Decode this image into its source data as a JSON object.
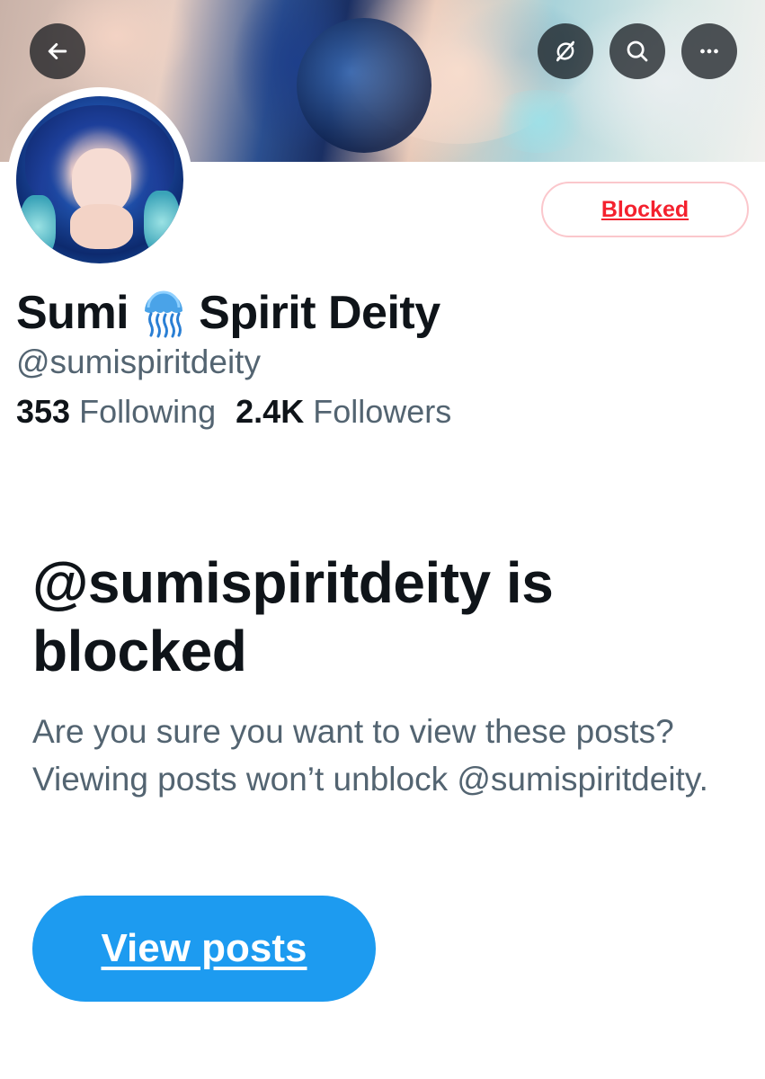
{
  "header": {
    "back_icon": "arrow-left-icon",
    "sync_icon": "no-sync-icon",
    "search_icon": "search-icon",
    "more_icon": "more-horizontal-icon"
  },
  "profile": {
    "blocked_label": "Blocked",
    "display_name_first": "Sumi",
    "display_name_emoji": "jellyfish-icon",
    "display_name_last": "Spirit Deity",
    "handle": "@sumispiritdeity",
    "following_count": "353",
    "following_label": "Following",
    "followers_count": "2.4K",
    "followers_label": "Followers"
  },
  "blocked_notice": {
    "title": "@sumispiritdeity is blocked",
    "description": "Are you sure you want to view these posts? Viewing posts won’t unblock @sumispiritdeity.",
    "button_label": "View posts"
  },
  "colors": {
    "accent": "#1d9bf0",
    "blocked_red": "#f4212e",
    "text_primary": "#0f1419",
    "text_secondary": "#536471"
  }
}
